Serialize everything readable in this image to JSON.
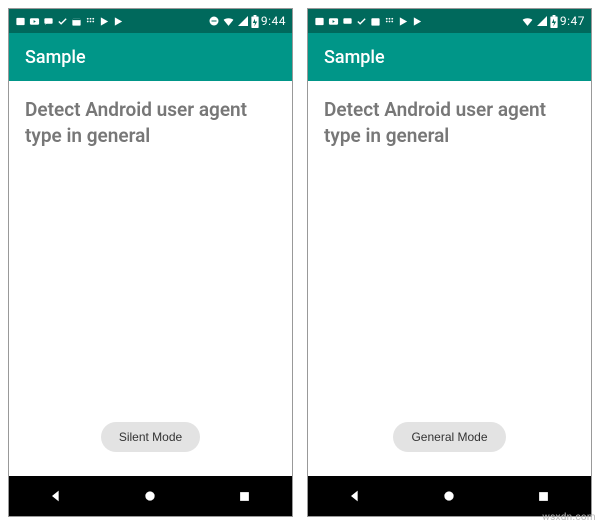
{
  "watermark": "wsxdn.com",
  "screens": [
    {
      "status": {
        "time": "9:44"
      },
      "appbar": {
        "title": "Sample"
      },
      "main": {
        "heading": "Detect Android user agent type in general",
        "button_label": "Silent Mode"
      }
    },
    {
      "status": {
        "time": "9:47"
      },
      "appbar": {
        "title": "Sample"
      },
      "main": {
        "heading": "Detect Android user agent type in general",
        "button_label": "General Mode"
      }
    }
  ]
}
